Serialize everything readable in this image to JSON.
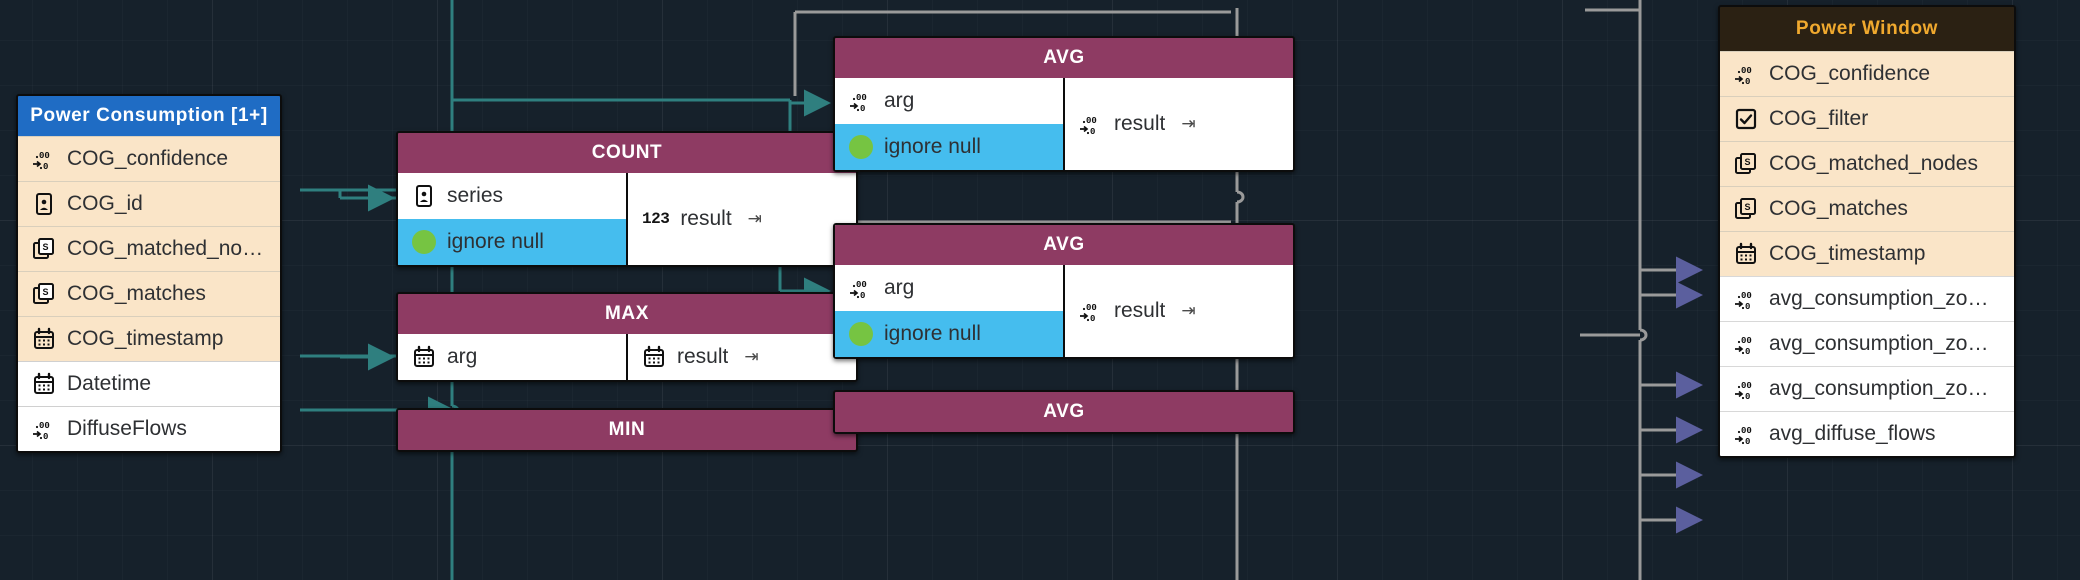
{
  "canvas": {
    "background": "#16212b",
    "grid": true
  },
  "colors": {
    "source_header": "#1f6cc4",
    "function_header": "#8e3b63",
    "window_header_bg": "#2b2113",
    "window_header_text": "#f0a92e",
    "field_tan": "#fae5c8",
    "field_white": "#ffffff",
    "option_cyan": "#45bdee",
    "bool_green": "#76c442",
    "wire_teal": "#2f7f7f",
    "wire_gray": "#9a9a9a",
    "arrow_purple": "#5b5f9e"
  },
  "source_node": {
    "title": "Power Consumption [1+]",
    "fields": [
      {
        "label": "COG_confidence",
        "icon": "decimal-icon",
        "style": "tan"
      },
      {
        "label": "COG_id",
        "icon": "id-card-icon",
        "style": "tan"
      },
      {
        "label": "COG_matched_nodes",
        "icon": "string-icon",
        "style": "tan"
      },
      {
        "label": "COG_matches",
        "icon": "string-icon",
        "style": "tan"
      },
      {
        "label": "COG_timestamp",
        "icon": "calendar-icon",
        "style": "tan"
      },
      {
        "label": "Datetime",
        "icon": "calendar-icon",
        "style": "white"
      },
      {
        "label": "DiffuseFlows",
        "icon": "decimal-icon",
        "style": "white"
      }
    ]
  },
  "window_node": {
    "title": "Power Window",
    "fields": [
      {
        "label": "COG_confidence",
        "icon": "decimal-icon",
        "style": "tan"
      },
      {
        "label": "COG_filter",
        "icon": "checkbox-icon",
        "style": "tan"
      },
      {
        "label": "COG_matched_nodes",
        "icon": "string-icon",
        "style": "tan"
      },
      {
        "label": "COG_matches",
        "icon": "string-icon",
        "style": "tan"
      },
      {
        "label": "COG_timestamp",
        "icon": "calendar-icon",
        "style": "tan"
      },
      {
        "label": "avg_consumption_zo…",
        "icon": "decimal-icon",
        "style": "white"
      },
      {
        "label": "avg_consumption_zo…",
        "icon": "decimal-icon",
        "style": "white"
      },
      {
        "label": "avg_consumption_zo…",
        "icon": "decimal-icon",
        "style": "white"
      },
      {
        "label": "avg_diffuse_flows",
        "icon": "decimal-icon",
        "style": "white"
      }
    ]
  },
  "function_nodes": [
    {
      "title": "COUNT",
      "inputs": [
        {
          "label": "series",
          "icon": "id-card-icon",
          "style": "white"
        },
        {
          "label": "ignore null",
          "icon": "bool-dot-icon",
          "style": "cyan"
        }
      ],
      "output": {
        "label": "result",
        "icon": "integer-123-icon",
        "suffix": "⇥"
      }
    },
    {
      "title": "MAX",
      "inputs": [
        {
          "label": "arg",
          "icon": "calendar-icon",
          "style": "white"
        }
      ],
      "output": {
        "label": "result",
        "icon": "calendar-icon",
        "suffix": "⇥"
      }
    },
    {
      "title": "MIN",
      "inputs": [],
      "output": null
    },
    {
      "title": "AVG",
      "inputs": [
        {
          "label": "arg",
          "icon": "decimal-icon",
          "style": "white"
        },
        {
          "label": "ignore null",
          "icon": "bool-dot-icon",
          "style": "cyan"
        }
      ],
      "output": {
        "label": "result",
        "icon": "decimal-icon",
        "suffix": "⇥"
      }
    },
    {
      "title": "AVG",
      "inputs": [
        {
          "label": "arg",
          "icon": "decimal-icon",
          "style": "white"
        },
        {
          "label": "ignore null",
          "icon": "bool-dot-icon",
          "style": "cyan"
        }
      ],
      "output": {
        "label": "result",
        "icon": "decimal-icon",
        "suffix": "⇥"
      }
    },
    {
      "title": "AVG",
      "inputs": [],
      "output": null
    }
  ]
}
